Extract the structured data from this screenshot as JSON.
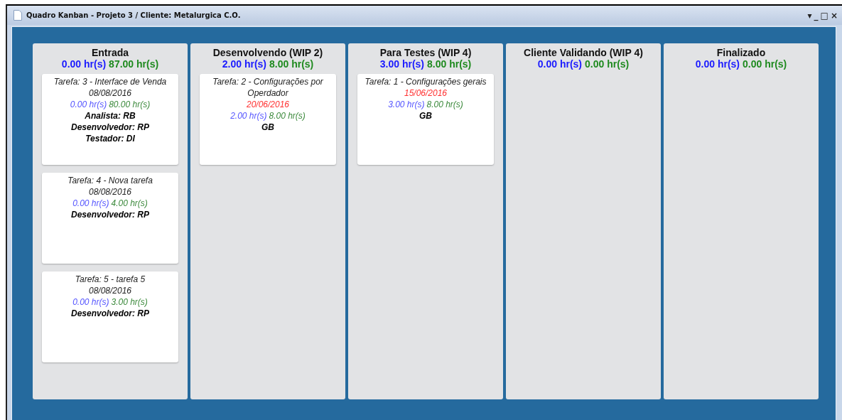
{
  "window": {
    "title": "Quadro Kanban - Projeto 3 / Cliente: Metalurgica C.O.",
    "controls": [
      "▾",
      "_",
      "□",
      "×"
    ]
  },
  "columns": [
    {
      "name": "Entrada",
      "spent": "0.00 hr(s)",
      "estimate": "87.00 hr(s)",
      "cards": [
        {
          "title": "Tarefa: 3 - Interface de Venda",
          "date": "08/08/2016",
          "overdue": false,
          "spent": "0.00 hr(s)",
          "estimate": "80.00 hr(s)",
          "people": [
            "Analista: RB",
            "Desenvolvedor: RP",
            "Testador: DI"
          ]
        },
        {
          "title": "Tarefa: 4 - Nova tarefa",
          "date": "08/08/2016",
          "overdue": false,
          "spent": "0.00 hr(s)",
          "estimate": "4.00 hr(s)",
          "people": [
            "Desenvolvedor: RP"
          ]
        },
        {
          "title": "Tarefa: 5 - tarefa 5",
          "date": "08/08/2016",
          "overdue": false,
          "spent": "0.00 hr(s)",
          "estimate": "3.00 hr(s)",
          "people": [
            "Desenvolvedor: RP"
          ]
        }
      ]
    },
    {
      "name": "Desenvolvendo (WIP 2)",
      "spent": "2.00 hr(s)",
      "estimate": "8.00 hr(s)",
      "cards": [
        {
          "title": "Tarefa: 2 - Configurações por Operdador",
          "date": "20/06/2016",
          "overdue": true,
          "spent": "2.00 hr(s)",
          "estimate": "8.00 hr(s)",
          "people": [
            "GB"
          ]
        }
      ]
    },
    {
      "name": "Para Testes (WIP 4)",
      "spent": "3.00 hr(s)",
      "estimate": "8.00 hr(s)",
      "cards": [
        {
          "title": "Tarefa: 1 - Configurações gerais",
          "date": "15/06/2016",
          "overdue": true,
          "spent": "3.00 hr(s)",
          "estimate": "8.00 hr(s)",
          "people": [
            "GB"
          ]
        }
      ]
    },
    {
      "name": "Cliente Validando (WIP 4)",
      "spent": "0.00 hr(s)",
      "estimate": "0.00 hr(s)"
    },
    {
      "name": "Finalizado",
      "spent": "0.00 hr(s)",
      "estimate": "0.00 hr(s)"
    }
  ]
}
